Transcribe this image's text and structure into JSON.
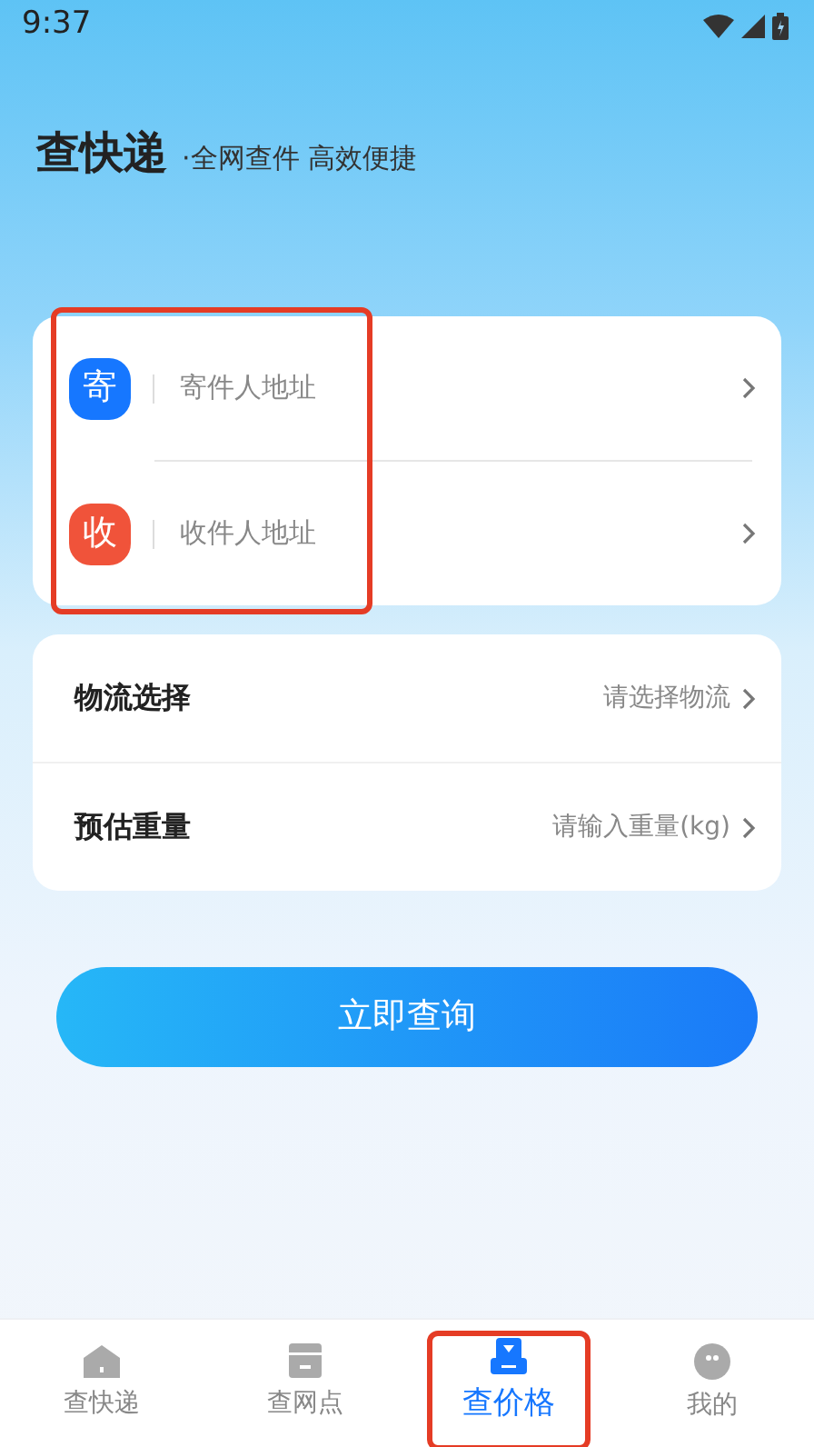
{
  "status_bar": {
    "time": "9:37"
  },
  "header": {
    "title": "查快递",
    "slogan": "·全网查件 高效便捷"
  },
  "addresses": {
    "highlighted": true,
    "rows": [
      {
        "badge": "寄",
        "color": "#1677ff",
        "placeholder": "寄件人地址"
      },
      {
        "badge": "收",
        "color": "#f0533a",
        "placeholder": "收件人地址"
      }
    ]
  },
  "options": [
    {
      "label": "物流选择",
      "placeholder": "请选择物流"
    },
    {
      "label": "预估重量",
      "placeholder": "请输入重量(kg)"
    }
  ],
  "submit_button": "立即查询",
  "tabs": [
    {
      "label": "查快递",
      "kind": "home",
      "selected": false,
      "highlighted": false
    },
    {
      "label": "查网点",
      "kind": "box",
      "selected": false,
      "highlighted": false
    },
    {
      "label": "查价格",
      "kind": "price",
      "selected": true,
      "highlighted": true
    },
    {
      "label": "我的",
      "kind": "face",
      "selected": false,
      "highlighted": false
    }
  ]
}
